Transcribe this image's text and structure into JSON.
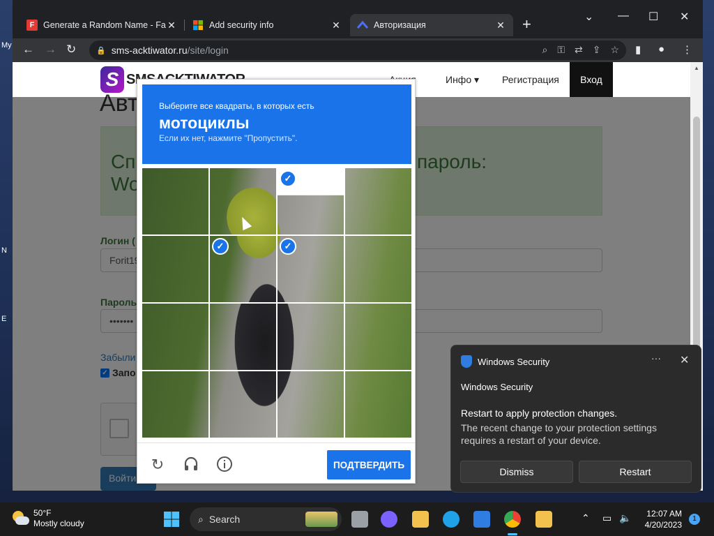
{
  "desktop": {
    "labels": [
      "My",
      "N",
      "E"
    ]
  },
  "browser": {
    "tabs": [
      {
        "title": "Generate a Random Name - Fak",
        "favicon_text": "F",
        "favicon_color": "#e53935"
      },
      {
        "title": "Add security info",
        "favicon_text": "",
        "favicon_color": "#f25022"
      },
      {
        "title": "Авторизация",
        "favicon_text": "",
        "favicon_color": "#3b5bdb"
      }
    ],
    "url_host": "sms-acktiwator.ru",
    "url_path": "/site/login"
  },
  "site": {
    "logo_letter": "S",
    "logo_word": "SMSACKTIWATOR",
    "nav": {
      "item1": "Акция",
      "info": "Инфо",
      "register": "Регистрация",
      "login": "Вход"
    },
    "page_title": "Авт",
    "alert_left": "Сп",
    "alert_left2": "Wo",
    "alert_right": "пароль:",
    "login_label": "Логин (",
    "login_value": "Forit19",
    "password_label": "Пароль",
    "password_value": "•••••••",
    "forgot": "Забыли",
    "remember": "Запо",
    "submit": "Войти"
  },
  "captcha": {
    "instruction": "Выберите все квадраты, в которых есть",
    "object": "мотоциклы",
    "hint": "Если их нет, нажмите \"Пропустить\".",
    "verify": "ПОДТВЕРДИТЬ",
    "selected": [
      2,
      5,
      6
    ]
  },
  "toast": {
    "header": "Windows Security",
    "app_name": "Windows Security",
    "title": "Restart to apply protection changes.",
    "body": "The recent change to your protection settings requires a restart of your device.",
    "dismiss": "Dismiss",
    "restart": "Restart"
  },
  "taskbar": {
    "temp": "50°F",
    "condition": "Mostly cloudy",
    "search": "Search",
    "time": "12:07 AM",
    "date": "4/20/2023",
    "notification_count": "1"
  }
}
